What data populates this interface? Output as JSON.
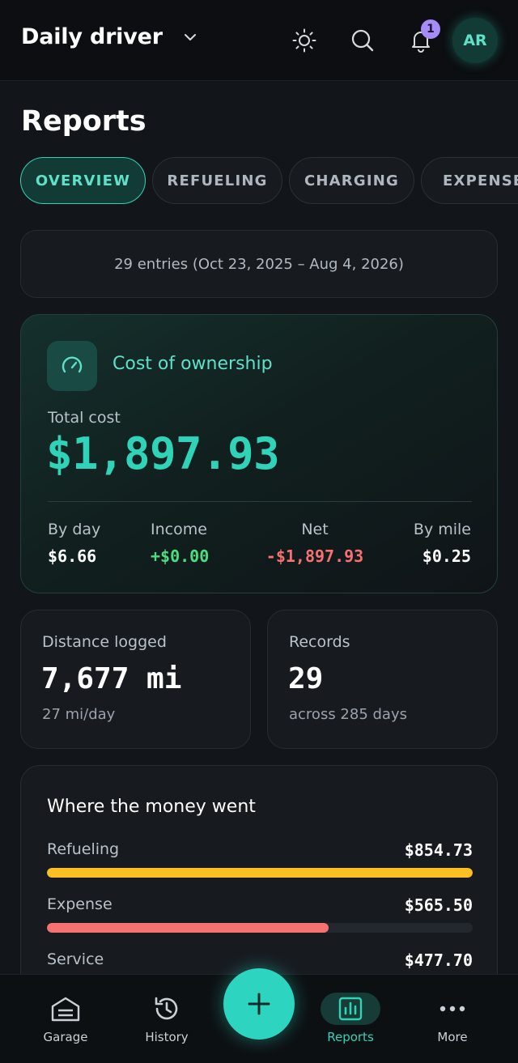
{
  "header": {
    "vehicle_name": "Daily driver",
    "notification_count": "1",
    "avatar_initials": "AR"
  },
  "page": {
    "title": "Reports"
  },
  "tabs": [
    {
      "label": "OVERVIEW",
      "active": true
    },
    {
      "label": "REFUELING",
      "active": false
    },
    {
      "label": "CHARGING",
      "active": false
    },
    {
      "label": "EXPENSE",
      "active": false
    }
  ],
  "summary": {
    "text": "29 entries (Oct 23, 2025 – Aug 4, 2026)"
  },
  "cost_card": {
    "heading": "Cost of ownership",
    "total_label": "Total cost",
    "total_value": "$1,897.93",
    "stats": [
      {
        "label": "By day",
        "value": "$6.66"
      },
      {
        "label": "Income",
        "value": "+$0.00"
      },
      {
        "label": "Net",
        "value": "-$1,897.93"
      },
      {
        "label": "By mile",
        "value": "$0.25"
      }
    ]
  },
  "distance_card": {
    "label": "Distance logged",
    "value": "7,677 mi",
    "sub": "27 mi/day"
  },
  "records_card": {
    "label": "Records",
    "value": "29",
    "sub": "across 285 days"
  },
  "breakdown": {
    "title": "Where the money went",
    "rows": [
      {
        "label": "Refueling",
        "amount": "$854.73",
        "share": 1.0,
        "color": "#fbbf24"
      },
      {
        "label": "Expense",
        "amount": "$565.50",
        "share": 0.662,
        "color": "#f87171"
      },
      {
        "label": "Service",
        "amount": "$477.70",
        "share": 0.559,
        "color": "#2dd4bf"
      }
    ]
  },
  "nav": {
    "items": [
      {
        "label": "Garage",
        "icon": "garage-icon"
      },
      {
        "label": "History",
        "icon": "history-icon"
      },
      {
        "label": "Reports",
        "icon": "bar-chart-icon",
        "active": true
      },
      {
        "label": "More",
        "icon": "more-dots-icon"
      }
    ],
    "fab_icon": "plus-icon"
  },
  "colors": {
    "accent": "#2dd4bf",
    "income": "#4ade80",
    "net_negative": "#f87171",
    "badge": "#a78bfa"
  }
}
